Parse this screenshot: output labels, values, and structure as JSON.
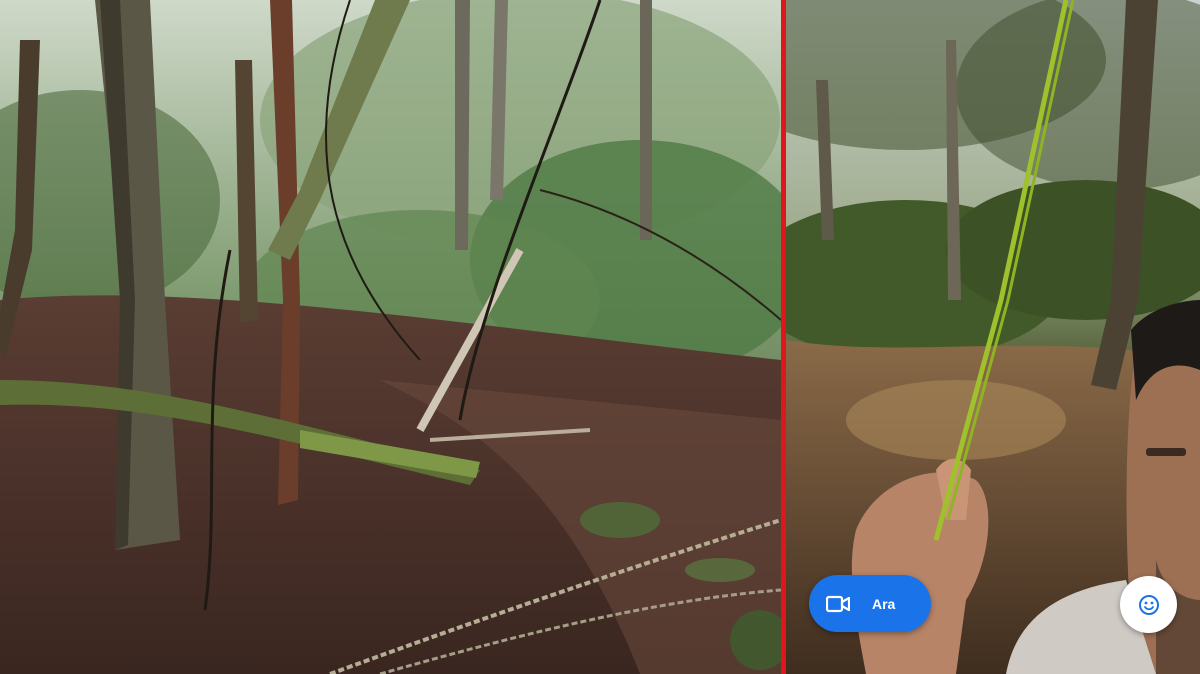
{
  "photos": {
    "left": {
      "subject": "forest-trail-with-rope"
    },
    "right": {
      "subject": "selfie-holding-rope-in-forest"
    }
  },
  "call_button": {
    "label": "Ara",
    "icon": "video-camera-icon"
  },
  "emoji_button": {
    "icon": "smiley-face-icon"
  },
  "colors": {
    "divider": "#e0161b",
    "call_button_bg": "#1a73e8",
    "emoji_button_bg": "#ffffff",
    "emoji_icon": "#1a73e8"
  }
}
